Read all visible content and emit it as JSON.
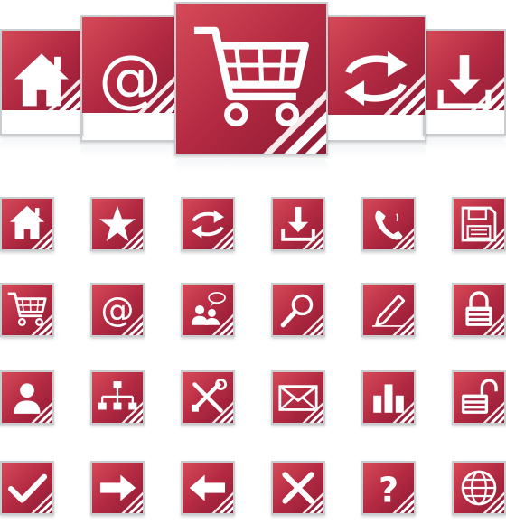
{
  "colors": {
    "tile_light": "#d64a58",
    "tile_mid": "#b42a42",
    "tile_dark": "#8e1a34",
    "border": "#c9cdd0",
    "glyph": "#ffffff",
    "stripe": "#ffffff"
  },
  "large_icons": [
    {
      "icon": "home-icon"
    },
    {
      "icon": "at-sign-icon"
    },
    {
      "icon": "shopping-cart-icon"
    },
    {
      "icon": "refresh-icon"
    },
    {
      "icon": "download-icon"
    }
  ],
  "small_icons": [
    {
      "icon": "home-icon"
    },
    {
      "icon": "star-icon"
    },
    {
      "icon": "refresh-icon"
    },
    {
      "icon": "download-icon"
    },
    {
      "icon": "phone-icon"
    },
    {
      "icon": "floppy-disk-icon"
    },
    {
      "icon": "shopping-cart-icon"
    },
    {
      "icon": "at-sign-icon"
    },
    {
      "icon": "users-chat-icon"
    },
    {
      "icon": "magnifier-icon"
    },
    {
      "icon": "pencil-icon"
    },
    {
      "icon": "padlock-icon"
    },
    {
      "icon": "user-icon"
    },
    {
      "icon": "sitemap-icon"
    },
    {
      "icon": "tools-icon"
    },
    {
      "icon": "envelope-icon"
    },
    {
      "icon": "bar-chart-icon"
    },
    {
      "icon": "unlocked-padlock-icon"
    },
    {
      "icon": "checkmark-icon"
    },
    {
      "icon": "arrow-right-icon"
    },
    {
      "icon": "arrow-left-icon"
    },
    {
      "icon": "close-x-icon"
    },
    {
      "icon": "question-icon"
    },
    {
      "icon": "globe-icon"
    }
  ]
}
